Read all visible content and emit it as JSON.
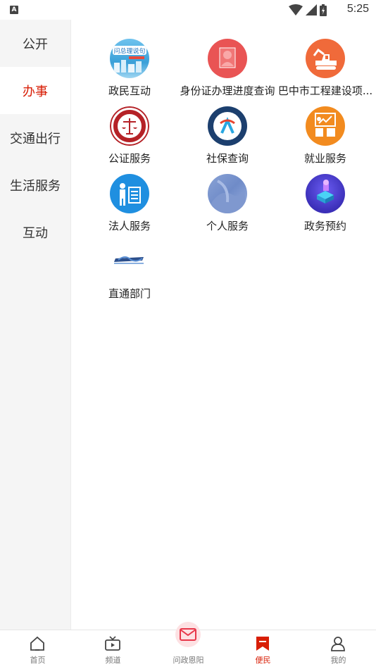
{
  "status_bar": {
    "time": "5:25",
    "notification_letter": "A"
  },
  "sidebar": {
    "items": [
      {
        "label": "公开",
        "active": false
      },
      {
        "label": "办事",
        "active": true
      },
      {
        "label": "交通出行",
        "active": false
      },
      {
        "label": "生活服务",
        "active": false
      },
      {
        "label": "互动",
        "active": false
      }
    ]
  },
  "services": [
    {
      "label": "政民互动",
      "icon": "wenzongli-poster-icon"
    },
    {
      "label": "身份证办理进度查询",
      "icon": "id-card-icon"
    },
    {
      "label": "巴中市工程建设项...",
      "icon": "excavator-icon"
    },
    {
      "label": "公证服务",
      "icon": "notary-seal-icon"
    },
    {
      "label": "社保查询",
      "icon": "social-security-logo-icon"
    },
    {
      "label": "就业服务",
      "icon": "employment-icon"
    },
    {
      "label": "法人服务",
      "icon": "legal-person-icon"
    },
    {
      "label": "个人服务",
      "icon": "personal-service-icon"
    },
    {
      "label": "政务预约",
      "icon": "appointment-icon"
    },
    {
      "label": "直通部门",
      "icon": "direct-department-logo-icon"
    }
  ],
  "poster_text": "问总理说句",
  "tabs": [
    {
      "label": "首页",
      "active": false
    },
    {
      "label": "频道",
      "active": false
    },
    {
      "label": "问政恩阳",
      "active": false
    },
    {
      "label": "便民",
      "active": true
    },
    {
      "label": "我的",
      "active": false
    }
  ],
  "colors": {
    "accent": "#d81e06",
    "sidebar_bg": "#f5f5f5"
  }
}
